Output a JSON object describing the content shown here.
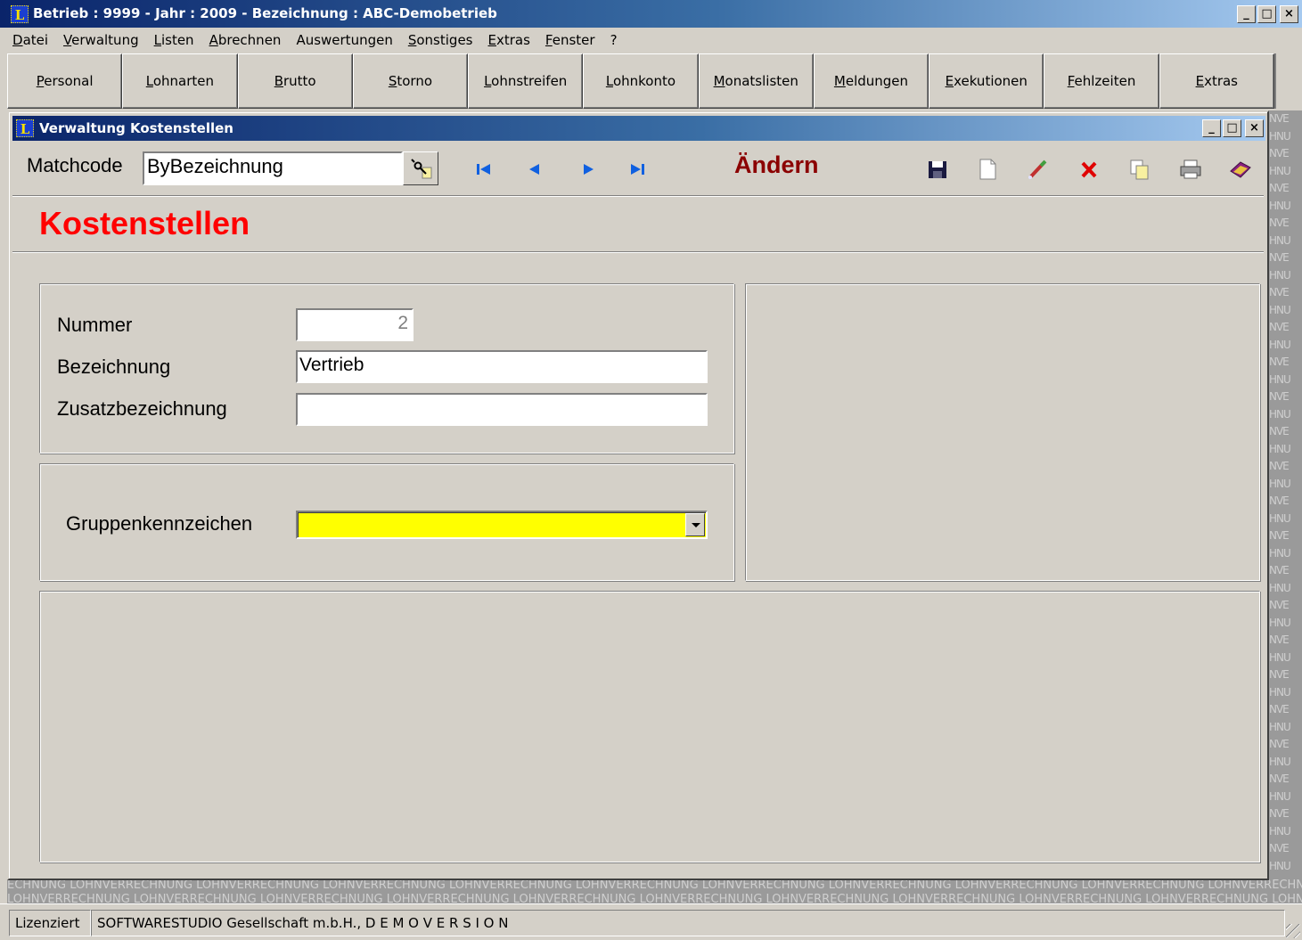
{
  "window": {
    "title": "Betrieb : 9999 - Jahr : 2009 - Bezeichnung : ABC-Demobetrieb",
    "logo_letter": "L",
    "buttons": {
      "minimize": "_",
      "maximize": "□",
      "close": "×"
    }
  },
  "menu": [
    "Datei",
    "Verwaltung",
    "Listen",
    "Abrechnen",
    "Auswertungen",
    "Sonstiges",
    "Extras",
    "Fenster",
    "?"
  ],
  "nav_buttons": [
    "Personal",
    "Lohnarten",
    "Brutto",
    "Storno",
    "Lohnstreifen",
    "Lohnkonto",
    "Monatslisten",
    "Meldungen",
    "Exekutionen",
    "Fehlzeiten",
    "Extras"
  ],
  "watermark": {
    "right": [
      "NVE",
      "HNU",
      "NVE",
      "HNU",
      "NVE",
      "HNU",
      "NVE",
      "HNU",
      "NVE",
      "HNU",
      "NVE",
      "HNU",
      "NVE",
      "HNU",
      "NVE",
      "HNU",
      "NVE",
      "HNU",
      "NVE",
      "HNU",
      "NVE",
      "HNU",
      "NVE",
      "HNU",
      "NVE",
      "HNU",
      "NVE",
      "HNU",
      "NVE",
      "HNU",
      "NVE",
      "HNU",
      "NVE",
      "HNU",
      "NVE",
      "HNU",
      "NVE",
      "HNU",
      "NVE",
      "HNU",
      "NVE",
      "HNU",
      "NVE",
      "HNU",
      "NVE",
      "HNU"
    ],
    "bottom_1": "ECHNUNG LOHNVERRECHNUNG LOHNVERRECHNUNG LOHNVERRECHNUNG LOHNVERRECHNUNG LOHNVERRECHNUNG LOHNVERRECHNUNG LOHNVERRECHNUNG LOHNVERRECHNUNG LOHNVERRECHNUNG LOHNVERRECHNUNG LOHNVERRECHNUNG LOHNVERRECHNUNG LOHNVE",
    "bottom_2": "LOHNVERRECHNUNG LOHNVERRECHNUNG LOHNVERRECHNUNG LOHNVERRECHNUNG LOHNVERRECHNUNG LOHNVERRECHNUNG LOHNVERRECHNUNG LOHNVERRECHNUNG LOHNVERRECHNUNG LOHNVERRECHNUNG LOHNVERRECHNUNG"
  },
  "child": {
    "title": "Verwaltung Kostenstellen",
    "matchcode_label": "Matchcode",
    "matchcode_value": "ByBezeichnung",
    "mode": "Ändern",
    "heading": "Kostenstellen",
    "icons": [
      "first-record-icon",
      "prev-record-icon",
      "next-record-icon",
      "last-record-icon",
      "save-icon",
      "new-document-icon",
      "edit-icon",
      "delete-icon",
      "copy-icon",
      "print-icon",
      "help-book-icon"
    ]
  },
  "form": {
    "nummer_label": "Nummer",
    "nummer_value": "2",
    "bezeichnung_label": "Bezeichnung",
    "bezeichnung_value": "Vertrieb",
    "zusatz_label": "Zusatzbezeichnung",
    "zusatz_value": "",
    "gruppe_label": "Gruppenkennzeichen",
    "gruppe_value": ""
  },
  "status": {
    "license": "Lizenziert",
    "company": "SOFTWARESTUDIO Gesellschaft m.b.H., D E M O V E R S I O N"
  },
  "colors": {
    "titlebar_start": "#0a246a",
    "heading": "#ff0000",
    "mode": "#8b0000",
    "combo_background": "#ffff00",
    "window_face": "#d4d0c8"
  }
}
